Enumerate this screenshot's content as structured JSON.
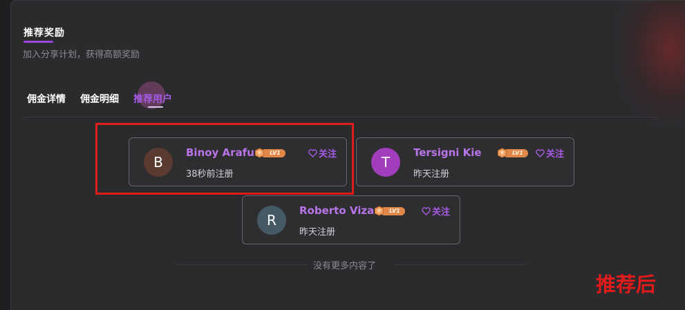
{
  "section": {
    "title": "推荐奖励",
    "subtitle": "加入分享计划，获得高额奖励"
  },
  "tabs": [
    {
      "label": "佣金详情",
      "active": false
    },
    {
      "label": "佣金明细",
      "active": false
    },
    {
      "label": "推荐用户",
      "active": true
    }
  ],
  "users": [
    {
      "initial": "B",
      "name": "Binoy Arafu",
      "level": "LV1",
      "follow": "关注",
      "registered": "38秒前注册",
      "avatar_color": "#5b3a31"
    },
    {
      "initial": "T",
      "name": "Tersigni Kie",
      "level": "LV1",
      "follow": "关注",
      "registered": "昨天注册",
      "avatar_color": "#a23dbb"
    },
    {
      "initial": "R",
      "name": "Roberto Viza",
      "level": "LV1",
      "follow": "关注",
      "registered": "昨天注册",
      "avatar_color": "#455a64"
    }
  ],
  "empty_text": "没有更多内容了",
  "annotation": "推荐后",
  "colors": {
    "accent": "#a85be8",
    "annotation_red": "#e01b1b",
    "badge_orange": "#e0884a"
  }
}
